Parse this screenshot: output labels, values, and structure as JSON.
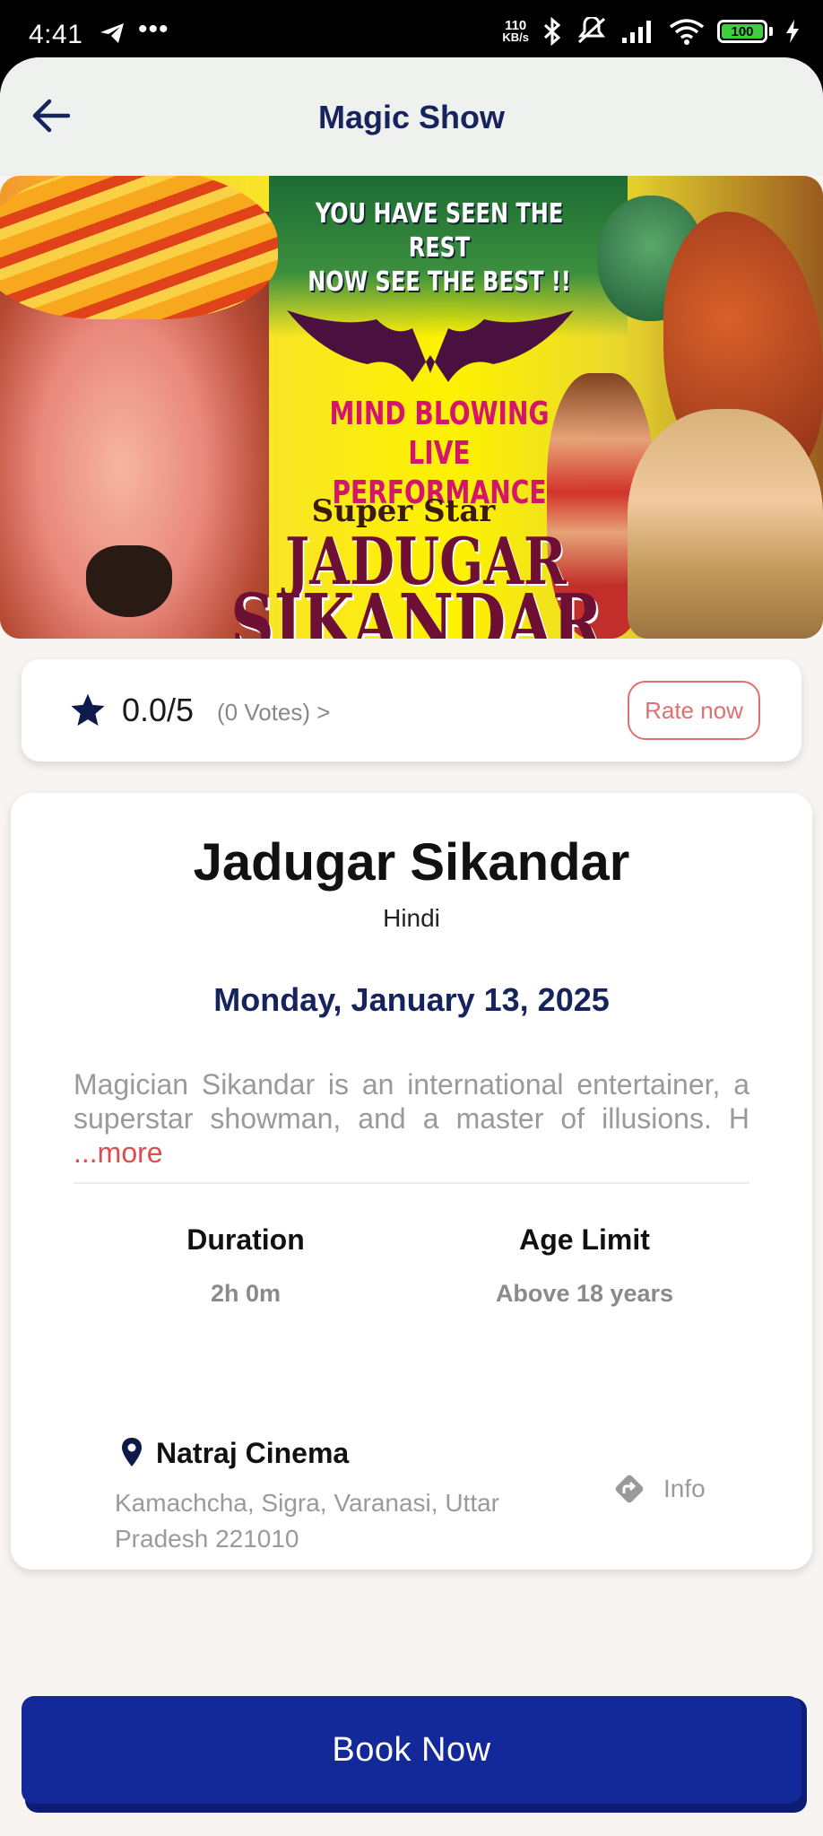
{
  "status_bar": {
    "time": "4:41",
    "dots": "•••",
    "net_speed_value": "110",
    "net_speed_unit": "KB/s",
    "battery": "100"
  },
  "header": {
    "title": "Magic Show"
  },
  "banner": {
    "line1": "YOU HAVE SEEN THE REST",
    "line2": "NOW SEE THE BEST !!",
    "line3": "MIND BLOWING LIVE",
    "line4": "PERFORMANCE",
    "line5": "Super Star",
    "line6": "JADUGAR",
    "line7": "SIKANDAR"
  },
  "rating": {
    "score": "0.0/5",
    "votes": "(0 Votes) >",
    "rate_label": "Rate now",
    "star_color": "#0d1b4c"
  },
  "event": {
    "title": "Jadugar Sikandar",
    "language": "Hindi",
    "date": "Monday, January 13, 2025",
    "description": "Magician Sikandar is an international entertainer, a superstar showman, and a master of illusions. H",
    "more_label": "...more",
    "duration_label": "Duration",
    "duration_value": "2h 0m",
    "age_label": "Age Limit",
    "age_value": "Above 18 years"
  },
  "venue": {
    "name": "Natraj Cinema",
    "address": "Kamachcha, Sigra, Varanasi, Uttar Pradesh 221010",
    "info_label": "Info"
  },
  "footer": {
    "book_label": "Book Now",
    "accent": "#13299a"
  },
  "icons": {
    "back": "arrow-left-icon",
    "star": "star-icon",
    "pin": "location-pin-icon",
    "info": "directions-icon"
  }
}
